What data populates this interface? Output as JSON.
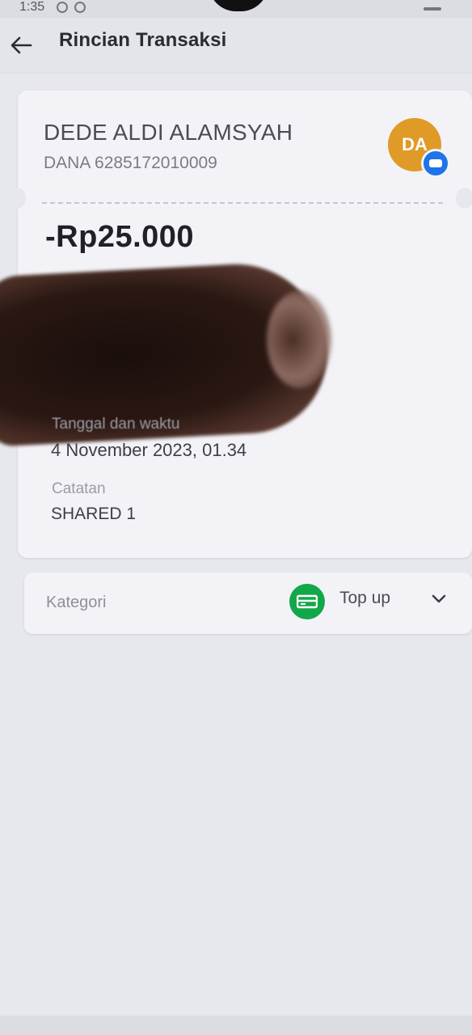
{
  "status_bar": {
    "time": "1:35"
  },
  "header": {
    "title": "Rincian Transaksi",
    "back_icon": "arrow-left-icon"
  },
  "recipient": {
    "name": "DEDE ALDI ALAMSYAH",
    "account": "DANA 6285172010009",
    "avatar_initials": "DA",
    "avatar_color": "#e09a27",
    "badge_icon": "wallet-icon",
    "badge_color": "#1e74e8"
  },
  "transaction": {
    "amount": "-Rp25.000",
    "datetime_label": "Tanggal dan waktu",
    "datetime_value": "4 November 2023, 01.34",
    "note_label": "Catatan",
    "note_value": "SHARED 1"
  },
  "category": {
    "label": "Kategori",
    "value": "Top up",
    "icon": "topup-card-icon",
    "icon_color": "#12a84a",
    "chevron_icon": "chevron-down-icon"
  }
}
